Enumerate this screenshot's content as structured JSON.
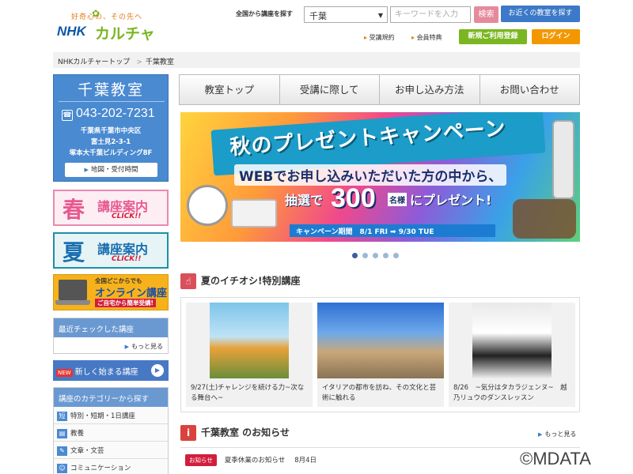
{
  "header": {
    "logo_tagline": "好奇心の、その先へ",
    "logo_nhk": "NHK",
    "logo_culture": "カルチャー",
    "search_label": "全国から講座を探す",
    "prefecture": "千葉",
    "keyword_placeholder": "キーワードを入力",
    "search_button": "検索",
    "nearby_button": "お近くの教室を探す",
    "terms_link": "受講規約",
    "member_link": "会員特典",
    "signup_button": "新規ご利用登録",
    "login_button": "ログイン"
  },
  "breadcrumb": {
    "home": "NHKカルチャートップ",
    "sep": ">",
    "current": "千葉教室"
  },
  "school": {
    "name": "千葉教室",
    "tel": "043-202-7231",
    "addr1": "千葉県千葉市中央区",
    "addr2": "富士見2-3-1",
    "addr3": "塚本大千葉ビルディング8F",
    "map_button": "地図・受付時間"
  },
  "banners": {
    "spring_big": "春",
    "spring_text": "講座案内",
    "spring_click": "CLICK!!",
    "summer_big": "夏",
    "summer_text": "講座案内",
    "summer_click": "CLICK!!",
    "online_l1": "全国どこからでも",
    "online_l2": "オンライン講座",
    "online_l3": "ご自宅から簡単受講!"
  },
  "sidebar": {
    "recent_title": "最近チェックした講座",
    "recent_more": "もっと見る",
    "new_badge": "NEW",
    "new_courses": "新しく始まる講座",
    "category_title": "講座のカテゴリーから探す",
    "categories": [
      {
        "icon": "短",
        "label": "特別・短期・1日講座"
      },
      {
        "icon": "教",
        "label": "教養"
      },
      {
        "icon": "文",
        "label": "文章・文芸"
      },
      {
        "icon": "コ",
        "label": "コミュニケーション"
      }
    ]
  },
  "nav": [
    "教室トップ",
    "受講に際して",
    "お申し込み方法",
    "お問い合わせ"
  ],
  "campaign": {
    "headline": "秋のプレゼントキャンペーン",
    "sub": "WEBでお申し込みいただいた方の中から、",
    "lottery": "抽選で",
    "count": "300",
    "unit": "名様",
    "present": "にプレゼント!",
    "period": "キャンペーン期間　8/1 FRI ➡ 9/30 TUE"
  },
  "recommend": {
    "title": "夏のイチオシ!特別講座",
    "cards": [
      "9/27(土)チャレンジを続ける力~次なる舞台へ~",
      "イタリアの都市を訪ね、その文化と芸術に触れる",
      "8/26　~気分はタカラジェンヌ~　越乃リュウのダンスレッスン"
    ]
  },
  "notice": {
    "title": "千葉教室 のお知らせ",
    "more": "もっと見る",
    "badge": "お知らせ",
    "item": "夏季休業のお知らせ",
    "date": "8月4日"
  },
  "copyright": "©MDATA"
}
